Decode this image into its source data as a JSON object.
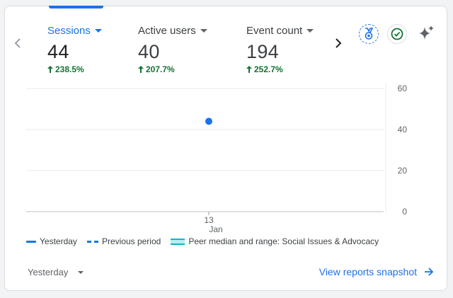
{
  "metrics": [
    {
      "name": "Sessions",
      "value": "44",
      "change": "238.5%",
      "active": true
    },
    {
      "name": "Active users",
      "value": "40",
      "change": "207.7%"
    },
    {
      "name": "Event count",
      "value": "194",
      "change": "252.7%"
    }
  ],
  "chart_data": {
    "type": "line",
    "x_ticks": [
      {
        "day": "13",
        "month": "Jan"
      }
    ],
    "y_ticks": [
      "60",
      "40",
      "20",
      "0"
    ],
    "ylim": [
      0,
      60
    ],
    "series": [
      {
        "name": "Yesterday",
        "points": [
          {
            "x": "13 Jan",
            "y": 44
          }
        ],
        "color": "#1a73e8"
      }
    ],
    "grid": true
  },
  "legend": {
    "yesterday": "Yesterday",
    "previous": "Previous period",
    "peer": "Peer median and range: Social Issues & Advocacy"
  },
  "footer": {
    "date_range": "Yesterday",
    "view_link": "View reports snapshot"
  },
  "colors": {
    "accent": "#1a73e8",
    "positive": "#137333",
    "band": "#12b5cb"
  }
}
